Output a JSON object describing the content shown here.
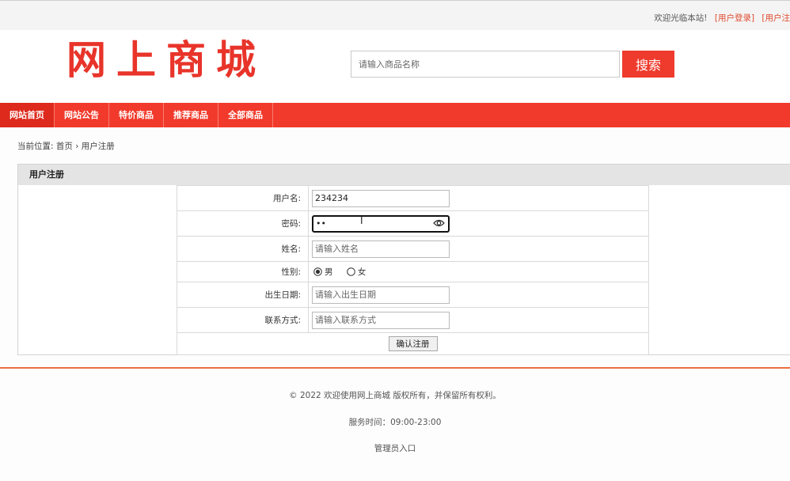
{
  "topbar": {
    "welcome": "欢迎光临本站!",
    "login_link": "[用户登录]",
    "register_link": "[用户注"
  },
  "header": {
    "logo_text": "网上商城",
    "search_placeholder": "请输入商品名称",
    "search_button": "搜索"
  },
  "nav": {
    "items": [
      "网站首页",
      "网站公告",
      "特价商品",
      "推荐商品",
      "全部商品"
    ]
  },
  "breadcrumb": {
    "prefix": "当前位置:",
    "home": "首页",
    "separator": "›",
    "current": "用户注册"
  },
  "panel": {
    "title": "用户注册"
  },
  "form": {
    "username_label": "用户名:",
    "username_value": "234234",
    "password_label": "密码:",
    "password_value": "••",
    "name_label": "姓名:",
    "name_placeholder": "请输入姓名",
    "gender_label": "性别:",
    "gender_options": [
      "男",
      "女"
    ],
    "gender_selected": "男",
    "birth_label": "出生日期:",
    "birth_placeholder": "请输入出生日期",
    "contact_label": "联系方式:",
    "contact_placeholder": "请输入联系方式",
    "submit_label": "确认注册"
  },
  "footer": {
    "copyright": "© 2022 欢迎使用网上商城 版权所有，并保留所有权利。",
    "service_hours": "服务时间：09:00-23:00",
    "admin_link": "管理员入口"
  },
  "colors": {
    "brand_red": "#f13a2b",
    "logo_red": "#e8342a",
    "link_red": "#e04a2f",
    "footer_line": "#ec6e3e"
  }
}
